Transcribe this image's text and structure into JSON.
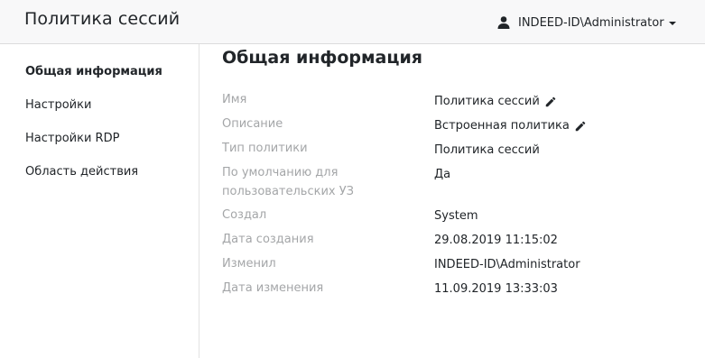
{
  "header": {
    "title": "Политика сессий",
    "user_name": "INDEED-ID\\Administrator"
  },
  "sidebar": {
    "items": [
      {
        "label": "Общая информация",
        "active": true
      },
      {
        "label": "Настройки",
        "active": false
      },
      {
        "label": "Настройки RDP",
        "active": false
      },
      {
        "label": "Область действия",
        "active": false
      }
    ]
  },
  "main": {
    "section_title": "Общая информация",
    "rows": [
      {
        "label": "Имя",
        "value": "Политика сессий",
        "editable": true
      },
      {
        "label": "Описание",
        "value": "Встроенная политика",
        "editable": true
      },
      {
        "label": "Тип политики",
        "value": "Политика сессий",
        "editable": false
      },
      {
        "label": "По умолчанию для пользовательских УЗ",
        "value": "Да",
        "editable": false
      },
      {
        "label": "Создал",
        "value": "System",
        "editable": false
      },
      {
        "label": "Дата создания",
        "value": "29.08.2019 11:15:02",
        "editable": false
      },
      {
        "label": "Изменил",
        "value": "INDEED-ID\\Administrator",
        "editable": false
      },
      {
        "label": "Дата изменения",
        "value": "11.09.2019 13:33:03",
        "editable": false
      }
    ]
  },
  "icons": {
    "user": "user-icon",
    "caret": "chevron-down-icon",
    "edit": "pencil-icon"
  }
}
